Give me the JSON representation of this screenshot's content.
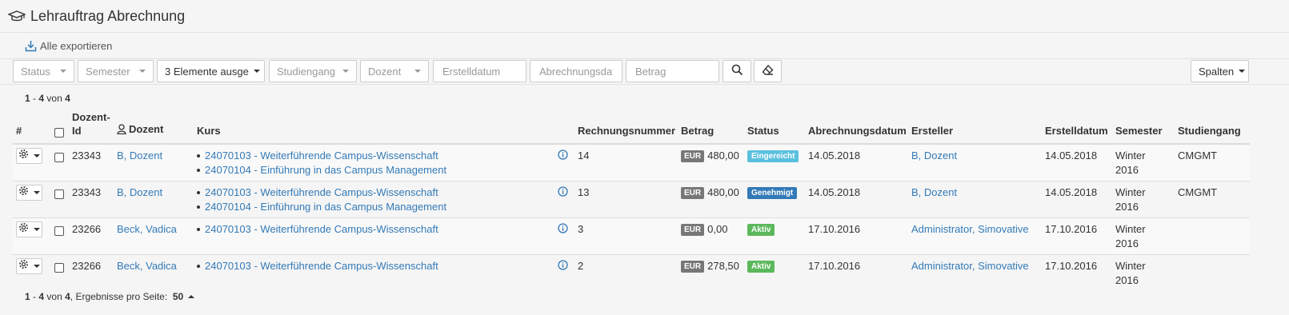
{
  "header": {
    "title": "Lehrauftrag Abrechnung",
    "icon": "graduation-cap-icon"
  },
  "toolbar": {
    "export_label": "Alle exportieren"
  },
  "filters": {
    "status": "Status",
    "semester": "Semester",
    "dozent_selected": "3 Elemente ausge",
    "studiengang": "Studiengang",
    "dozent": "Dozent",
    "erstelldatum_placeholder": "Erstelldatum",
    "abrechnungsdatum_placeholder": "Abrechnungsdatum",
    "betrag_placeholder": "Betrag",
    "columns_label": "Spalten"
  },
  "summary": {
    "from": "1",
    "to": "4",
    "of_label": "von",
    "total": "4"
  },
  "table": {
    "headers": {
      "hash": "#",
      "dozent_id": "Dozent-Id",
      "dozent": "Dozent",
      "kurs": "Kurs",
      "rechnungsnummer": "Rechnungsnummer",
      "betrag": "Betrag",
      "status": "Status",
      "abrechnungsdatum": "Abrechnungsdatum",
      "ersteller": "Ersteller",
      "erstelldatum": "Erstelldatum",
      "semester": "Semester",
      "studiengang": "Studiengang"
    },
    "rows": [
      {
        "dozent_id": "23343",
        "dozent": "B, Dozent",
        "kurse": [
          "24070103 - Weiterführende Campus-Wissenschaft",
          "24070104 - Einführung in das Campus Management"
        ],
        "rechnungsnummer": "14",
        "currency": "EUR",
        "betrag": "480,00",
        "status": "Eingereicht",
        "status_color": "#5bc0de",
        "abrechnungsdatum": "14.05.2018",
        "ersteller": "B, Dozent",
        "erstelldatum": "14.05.2018",
        "semester": "Winter 2016",
        "studiengang": "CMGMT"
      },
      {
        "dozent_id": "23343",
        "dozent": "B, Dozent",
        "kurse": [
          "24070103 - Weiterführende Campus-Wissenschaft",
          "24070104 - Einführung in das Campus Management"
        ],
        "rechnungsnummer": "13",
        "currency": "EUR",
        "betrag": "480,00",
        "status": "Genehmigt",
        "status_color": "#337ab7",
        "abrechnungsdatum": "14.05.2018",
        "ersteller": "B, Dozent",
        "erstelldatum": "14.05.2018",
        "semester": "Winter 2016",
        "studiengang": "CMGMT"
      },
      {
        "dozent_id": "23266",
        "dozent": "Beck, Vadica",
        "kurse": [
          "24070103 - Weiterführende Campus-Wissenschaft"
        ],
        "rechnungsnummer": "3",
        "currency": "EUR",
        "betrag": "0,00",
        "status": "Aktiv",
        "status_color": "#5cb85c",
        "abrechnungsdatum": "17.10.2016",
        "ersteller": "Administrator, Simovative",
        "erstelldatum": "17.10.2016",
        "semester": "Winter 2016",
        "studiengang": ""
      },
      {
        "dozent_id": "23266",
        "dozent": "Beck, Vadica",
        "kurse": [
          "24070103 - Weiterführende Campus-Wissenschaft"
        ],
        "rechnungsnummer": "2",
        "currency": "EUR",
        "betrag": "278,50",
        "status": "Aktiv",
        "status_color": "#5cb85c",
        "abrechnungsdatum": "17.10.2016",
        "ersteller": "Administrator, Simovative",
        "erstelldatum": "17.10.2016",
        "semester": "Winter 2016",
        "studiengang": ""
      }
    ]
  },
  "footer": {
    "from": "1",
    "to": "4",
    "of_label": "von",
    "total": "4",
    "per_page_label": ", Ergebnisse pro Seite:",
    "per_page": "50"
  }
}
